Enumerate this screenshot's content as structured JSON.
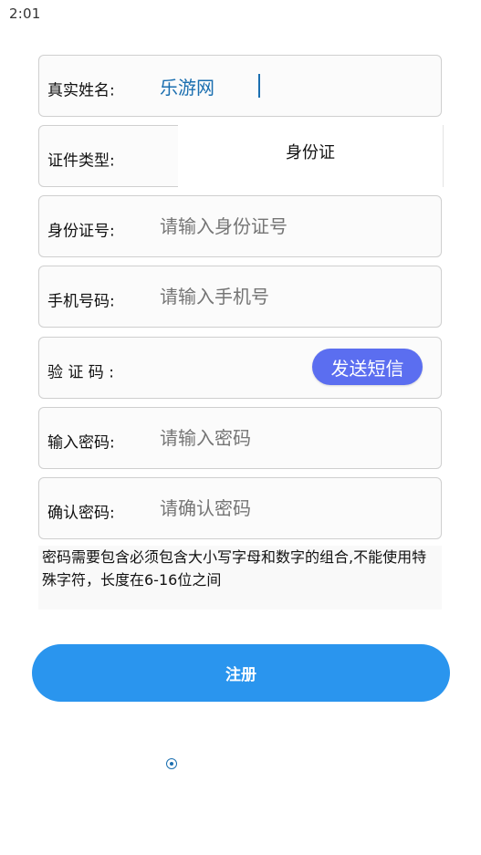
{
  "status_bar": {
    "time": "2:01"
  },
  "form": {
    "real_name": {
      "label": "真实姓名:",
      "value": "乐游网"
    },
    "id_type": {
      "label": "证件类型:",
      "selected": "身份证"
    },
    "id_number": {
      "label": "身份证号:",
      "placeholder": "请输入身份证号"
    },
    "phone": {
      "label": "手机号码:",
      "placeholder": "请输入手机号"
    },
    "verification_code": {
      "label": "验 证 码 :",
      "send_sms_label": "发送短信"
    },
    "password": {
      "label": "输入密码:",
      "placeholder": "请输入密码"
    },
    "confirm_password": {
      "label": "确认密码:",
      "placeholder": "请确认密码"
    },
    "password_hint": "密码需要包含必须包含大小写字母和数字的组合,不能使用特殊字符，长度在6-16位之间",
    "register_label": "注册"
  },
  "colors": {
    "accent": "#2a95ee",
    "sms_button": "#5b6ef0",
    "input_text": "#1b6fb0",
    "placeholder": "#9a9a9a"
  }
}
